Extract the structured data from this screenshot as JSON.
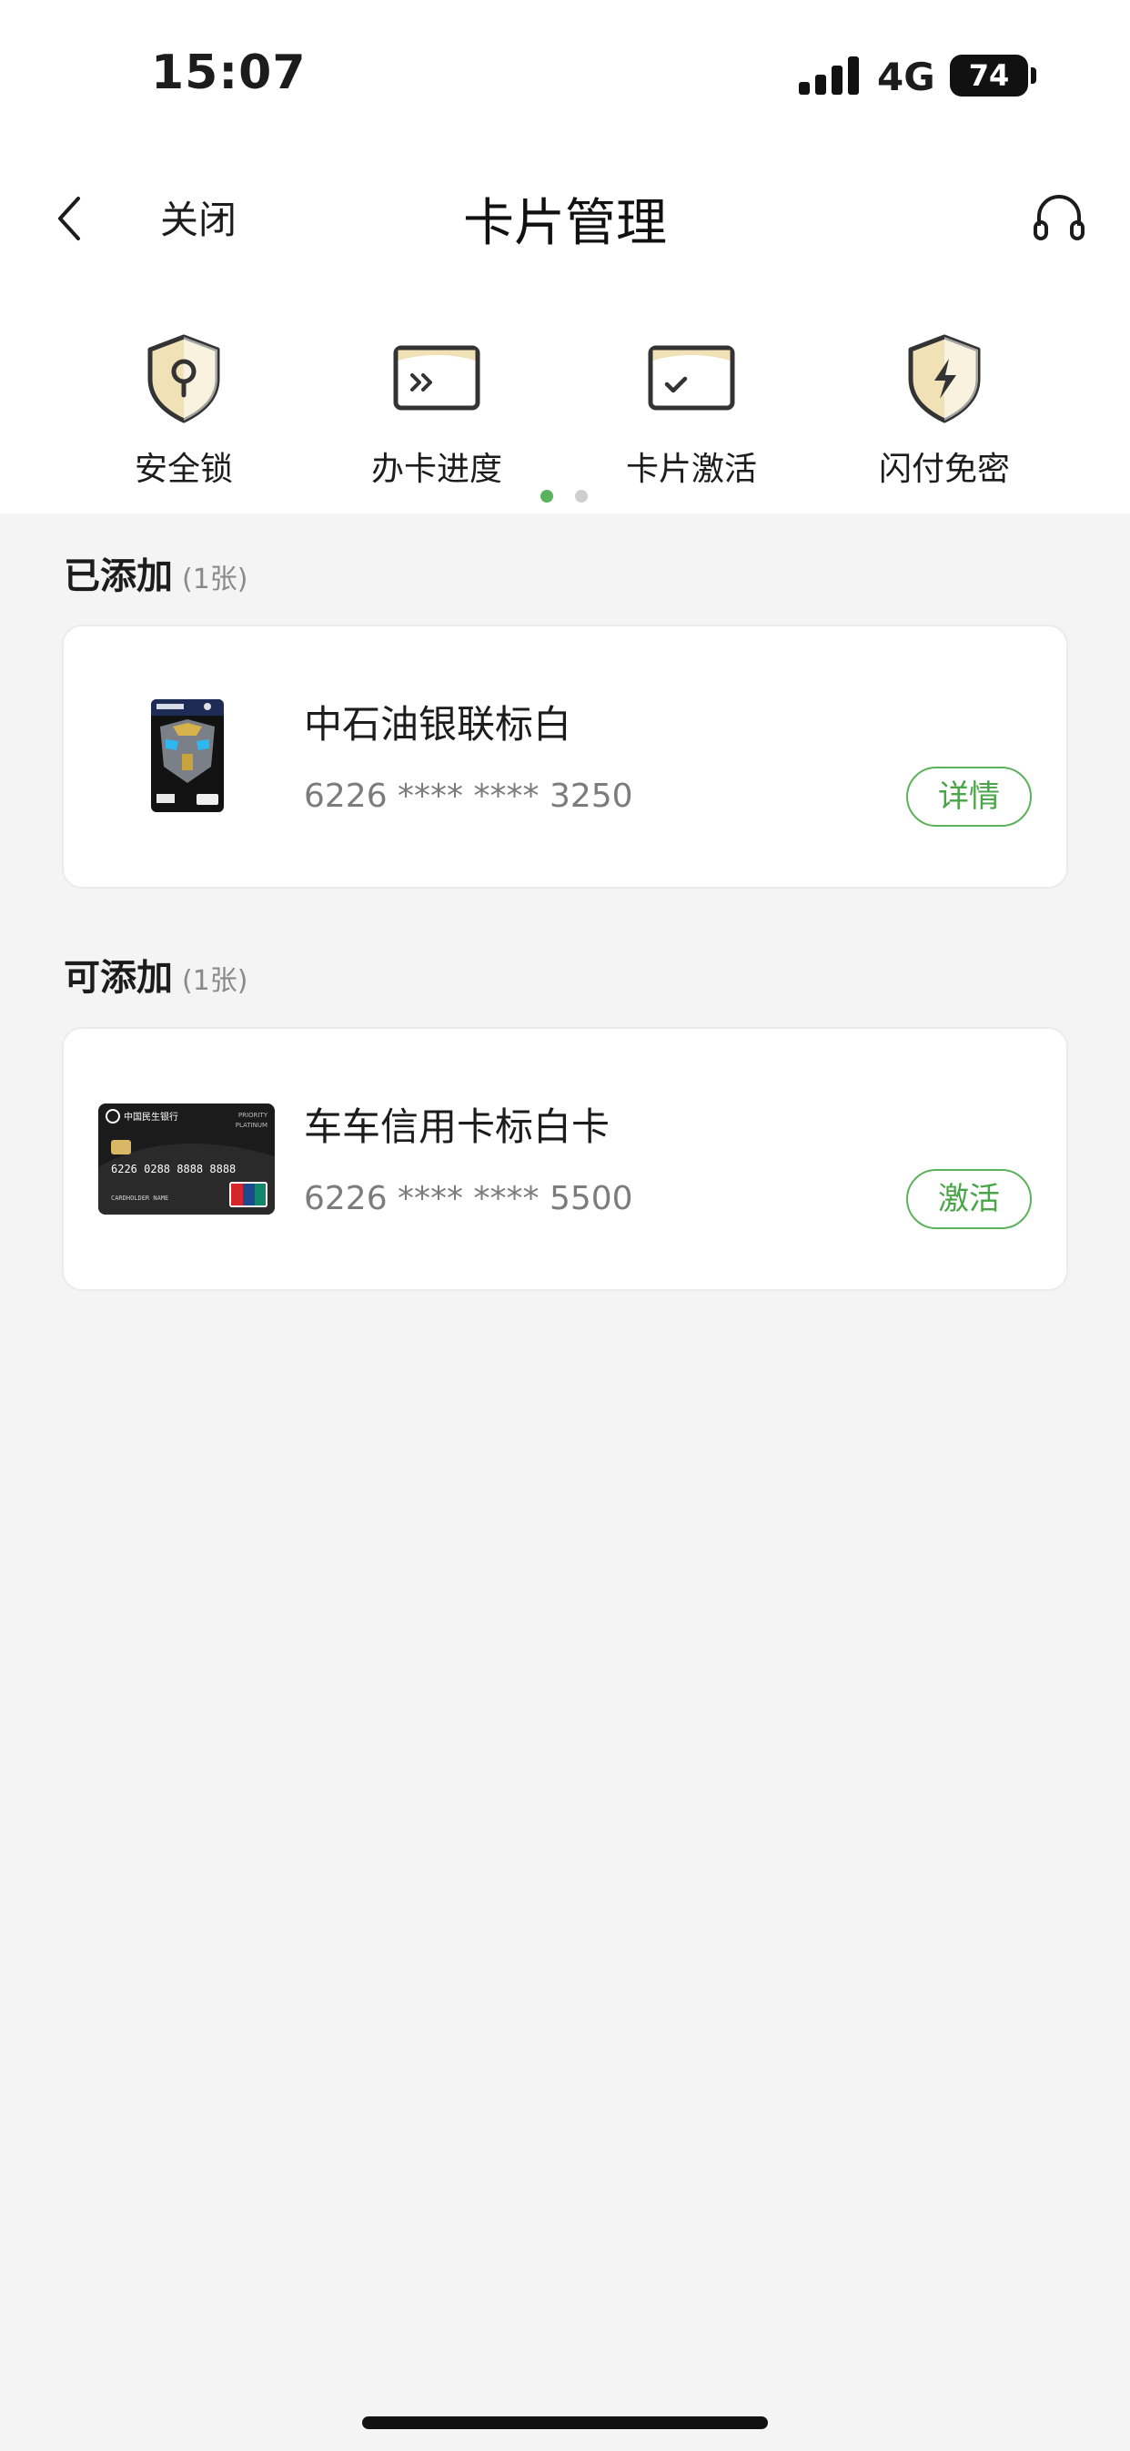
{
  "status_bar": {
    "time": "15:07",
    "network": "4G",
    "battery": "74"
  },
  "nav": {
    "close_label": "关闭",
    "title": "卡片管理"
  },
  "quick_actions": [
    {
      "label": "安全锁",
      "icon": "shield-lock-icon"
    },
    {
      "label": "办卡进度",
      "icon": "card-progress-icon"
    },
    {
      "label": "卡片激活",
      "icon": "card-activate-icon"
    },
    {
      "label": "闪付免密",
      "icon": "shield-flash-icon"
    }
  ],
  "pagination": {
    "total": 2,
    "active": 1
  },
  "added": {
    "title": "已添加",
    "count": "(1张)",
    "cards": [
      {
        "name": "中石油银联标白",
        "number": "6226 **** **** 3250",
        "action": "详情"
      }
    ]
  },
  "addable": {
    "title": "可添加",
    "count": "(1张)",
    "cards": [
      {
        "name": "车车信用卡标白卡",
        "number": "6226 **** **** 5500",
        "action": "激活",
        "card_face": {
          "bank": "中国民生银行",
          "tier": "PRIORITY",
          "level": "PLATINUM",
          "pan": "6226 0288 8888 8888",
          "holder": "CARDHOLDER NAME"
        }
      }
    ]
  },
  "colors": {
    "accent": "#5cb25c",
    "background": "#f4f4f4",
    "icon_gold": "#f0e2b6",
    "icon_stroke": "#333333"
  }
}
